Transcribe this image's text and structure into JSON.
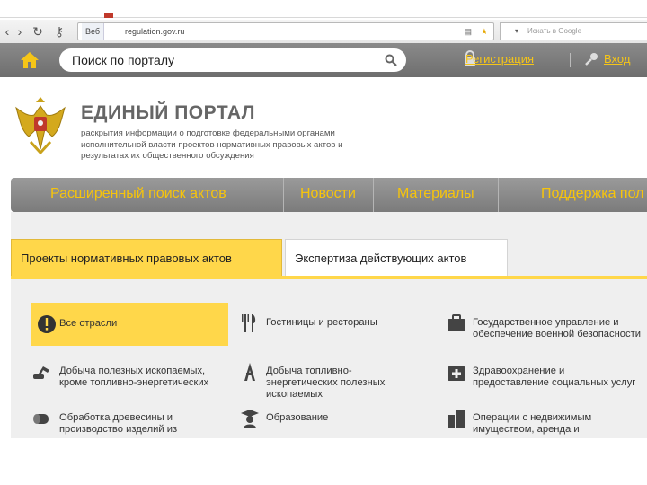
{
  "browser": {
    "site_label": "Веб",
    "url": "regulation.gov.ru",
    "search_placeholder": "Искать в Google"
  },
  "header": {
    "search_placeholder": "Поиск по порталу",
    "register_label": "Регистрация",
    "login_label": "Вход"
  },
  "portal": {
    "title": "ЕДИНЫЙ ПОРТАЛ",
    "description": "раскрытия информации о подготовке федеральными органами исполнительной власти проектов нормативных правовых актов и результатах их общественного обсуждения"
  },
  "menu": {
    "items": [
      "Расширенный поиск актов",
      "Новости",
      "Материалы",
      "Поддержка пол"
    ]
  },
  "tabs": {
    "projects": "Проекты нормативных правовых актов",
    "expertise": "Экспертиза действующих актов"
  },
  "industries": [
    {
      "label": "Все отрасли",
      "icon": "warning-icon"
    },
    {
      "label": "Гостиницы и рестораны",
      "icon": "fork-knife-icon"
    },
    {
      "label": "Государственное управление и обеспечение военной безопасности",
      "icon": "briefcase-icon"
    },
    {
      "label": "Добыча полезных ископаемых, кроме топливно-энергетических",
      "icon": "excavator-icon"
    },
    {
      "label": "Добыча топливно-энергетических полезных ископаемых",
      "icon": "oil-rig-icon"
    },
    {
      "label": "Здравоохранение и предоставление социальных услуг",
      "icon": "medical-bag-icon"
    },
    {
      "label": "Обработка древесины и производство изделий из дерева",
      "icon": "log-icon"
    },
    {
      "label": "Образование",
      "icon": "graduate-icon"
    },
    {
      "label": "Операции с недвижимым имуществом, аренда и предоставление услуг",
      "icon": "buildings-icon"
    }
  ],
  "colors": {
    "accent_yellow": "#ffd74a",
    "menu_text": "#f6c40c",
    "header_gray": "#7b7b7b"
  }
}
